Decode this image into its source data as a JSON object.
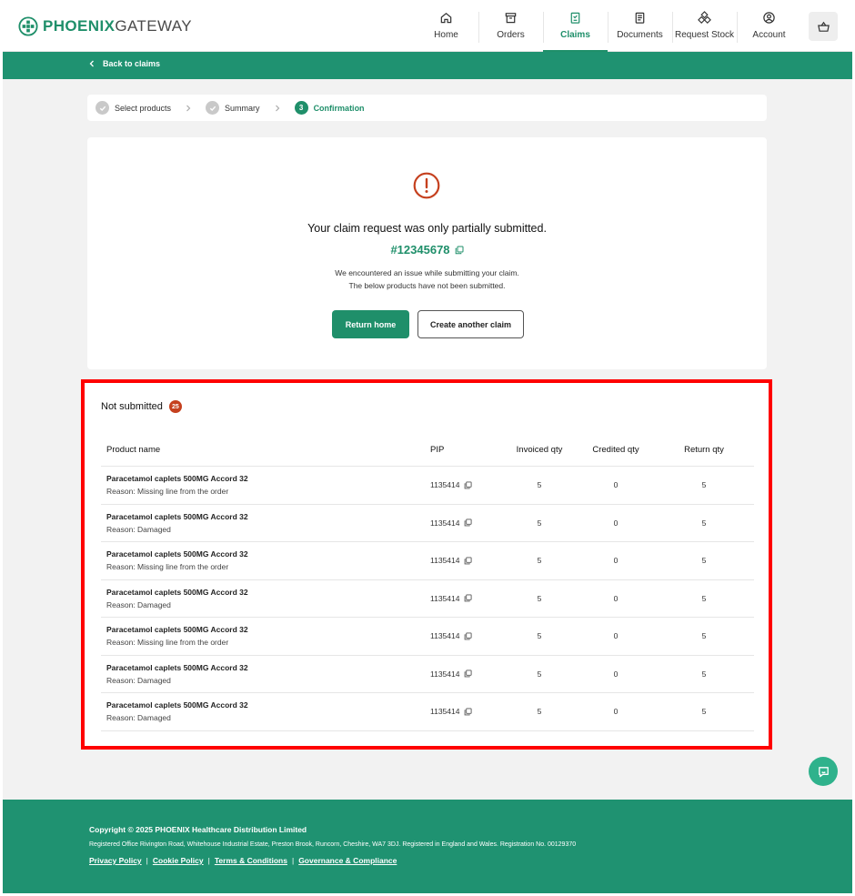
{
  "brand": {
    "bold": "PHOENIX",
    "light": "GATEWAY",
    "color": "#1f8f6a"
  },
  "nav": [
    {
      "label": "Home",
      "icon": "home-icon"
    },
    {
      "label": "Orders",
      "icon": "archive-box-icon"
    },
    {
      "label": "Claims",
      "icon": "claims-clipboard-icon",
      "active": true
    },
    {
      "label": "Documents",
      "icon": "document-icon"
    },
    {
      "label": "Request Stock",
      "icon": "boxes-icon"
    },
    {
      "label": "Account",
      "icon": "user-circle-icon"
    }
  ],
  "cart": {
    "icon": "basket-icon"
  },
  "back": {
    "label": "Back to claims"
  },
  "steps": [
    {
      "label": "Select products",
      "state": "done"
    },
    {
      "label": "Summary",
      "state": "done"
    },
    {
      "label": "Confirmation",
      "state": "active",
      "number": "3"
    }
  ],
  "confirmation": {
    "title": "Your claim request was only partially submitted.",
    "claim_number": "#12345678",
    "message_line1": "We encountered an issue while submitting your claim.",
    "message_line2": "The below products have not been submitted.",
    "primary_button": "Return home",
    "secondary_button": "Create another claim",
    "alert_color": "#c5401e"
  },
  "not_submitted": {
    "title": "Not submitted",
    "count": "25",
    "columns": {
      "name": "Product name",
      "pip": "PIP",
      "invoiced": "Invoiced qty",
      "credited": "Credited qty",
      "returned": "Return qty"
    },
    "rows": [
      {
        "name": "Paracetamol caplets 500MG Accord 32",
        "reason": "Reason: Missing line from the order",
        "pip": "1135414",
        "invoiced": "5",
        "credited": "0",
        "returned": "5"
      },
      {
        "name": "Paracetamol caplets 500MG Accord 32",
        "reason": "Reason: Damaged",
        "pip": "1135414",
        "invoiced": "5",
        "credited": "0",
        "returned": "5"
      },
      {
        "name": "Paracetamol caplets 500MG Accord 32",
        "reason": "Reason: Missing line from the order",
        "pip": "1135414",
        "invoiced": "5",
        "credited": "0",
        "returned": "5"
      },
      {
        "name": "Paracetamol caplets 500MG Accord 32",
        "reason": "Reason: Damaged",
        "pip": "1135414",
        "invoiced": "5",
        "credited": "0",
        "returned": "5"
      },
      {
        "name": "Paracetamol caplets 500MG Accord 32",
        "reason": "Reason: Missing line from the order",
        "pip": "1135414",
        "invoiced": "5",
        "credited": "0",
        "returned": "5"
      },
      {
        "name": "Paracetamol caplets 500MG Accord 32",
        "reason": "Reason: Damaged",
        "pip": "1135414",
        "invoiced": "5",
        "credited": "0",
        "returned": "5"
      },
      {
        "name": "Paracetamol caplets 500MG Accord 32",
        "reason": "Reason: Damaged",
        "pip": "1135414",
        "invoiced": "5",
        "credited": "0",
        "returned": "5"
      }
    ]
  },
  "chat": {
    "icon": "chat-bubble-icon"
  },
  "footer": {
    "copyright": "Copyright © 2025 PHOENIX Healthcare Distribution Limited",
    "address": "Registered Office Rivington Road, Whitehouse Industrial Estate, Preston Brook, Runcorn, Cheshire, WA7 3DJ. Registered in England and Wales. Registration No. 00129370",
    "links": [
      "Privacy Policy",
      "Cookie Policy",
      "Terms & Conditions",
      "Governance & Compliance"
    ],
    "separator": "|"
  },
  "colors": {
    "primary": "#1f8f6a",
    "band": "#1f9271",
    "alert": "#c5401e",
    "highlight_border": "#ff0000"
  }
}
